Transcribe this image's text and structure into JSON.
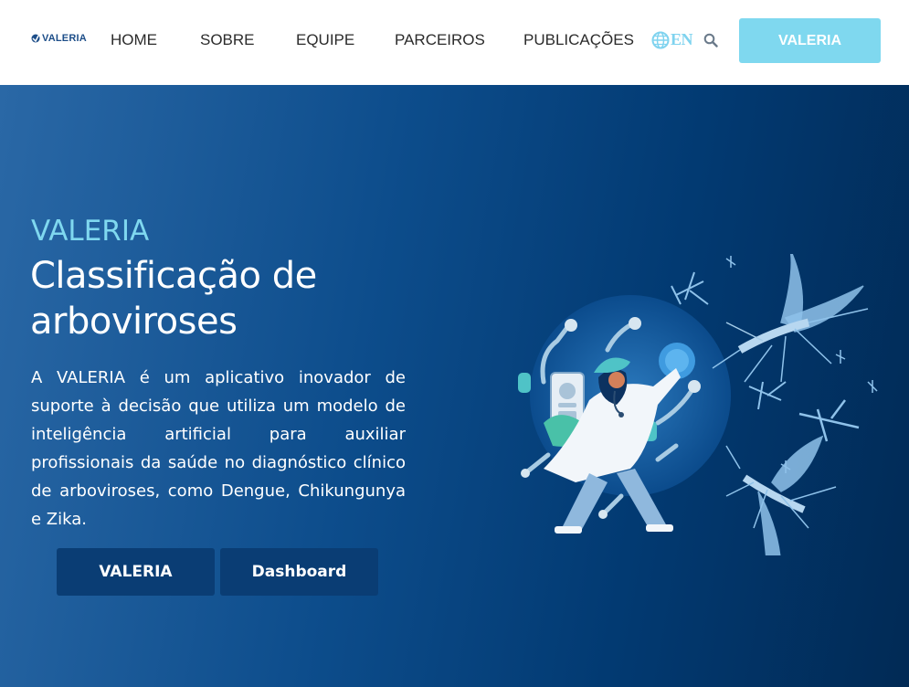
{
  "header": {
    "logo_text": "VALERIA",
    "nav": [
      "HOME",
      "SOBRE",
      "EQUIPE",
      "PARCEIROS",
      "PUBLICAÇÕES"
    ],
    "language_label": "EN",
    "cta_label": "VALERIA"
  },
  "hero": {
    "eyebrow": "VALERIA",
    "title": "Classificação de arboviroses",
    "description": "A VALERIA é um aplicativo inovador de suporte à decisão que utiliza um modelo de inteligência artificial para auxiliar profissionais da saúde no diagnóstico clínico de arboviroses, como Dengue, Chikungunya e Zika.",
    "buttons": [
      "VALERIA",
      "Dashboard"
    ]
  },
  "icons": {
    "logo": "logo-icon",
    "language": "globe-icon",
    "search": "search-icon"
  },
  "colors": {
    "accent": "#7fd8ef",
    "brand_dark": "#0a3d74",
    "hero_gradient_start": "#2a68a6",
    "hero_gradient_end": "#012a55"
  }
}
